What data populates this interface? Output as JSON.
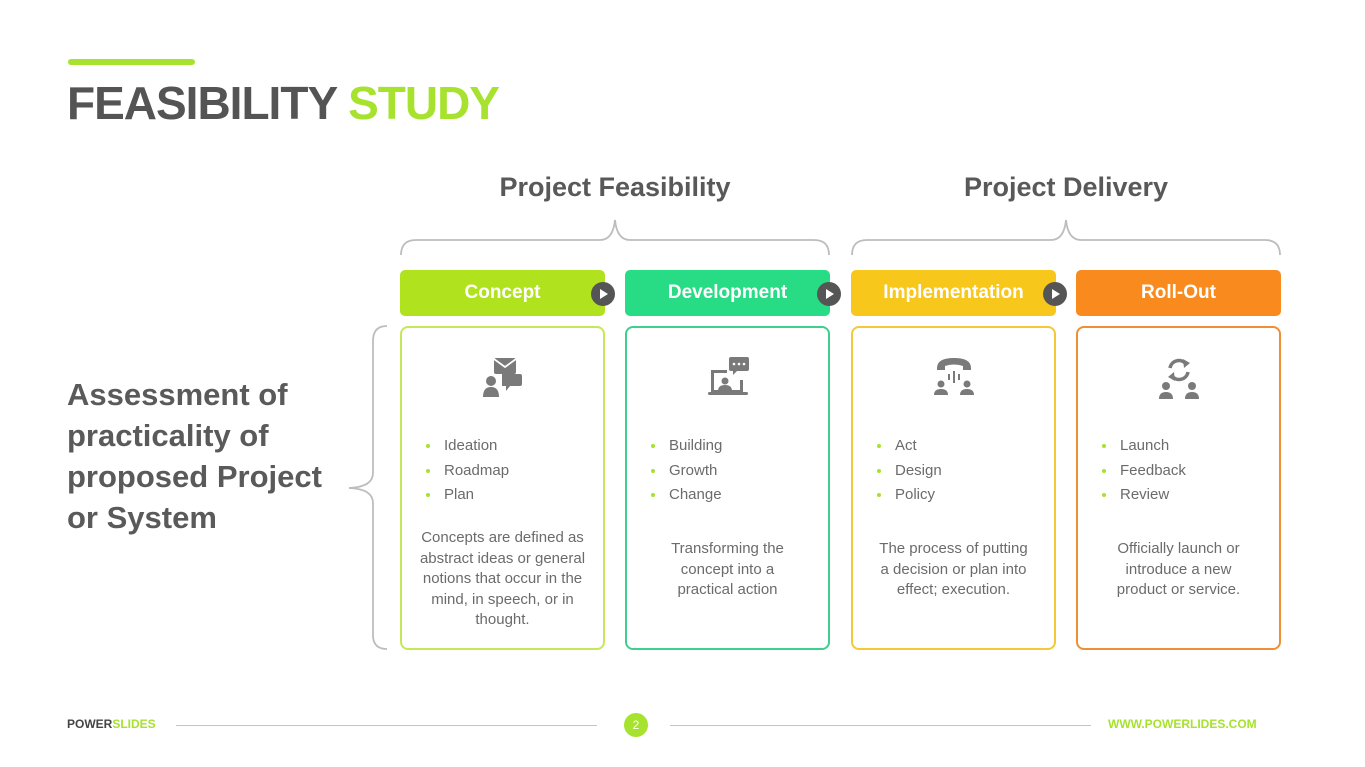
{
  "title": {
    "part1": "FEASIBILITY",
    "part2": "STUDY"
  },
  "groups": [
    {
      "label": "Project Feasibility"
    },
    {
      "label": "Project Delivery"
    }
  ],
  "left_text": "Assessment of practicality of proposed Project or System",
  "steps": [
    {
      "label": "Concept",
      "color": "#b0e31d",
      "border": "#c5e85a",
      "icon": "person-message-icon",
      "bullets": [
        "Ideation",
        "Roadmap",
        "Plan"
      ],
      "description": "Concepts are defined as abstract ideas or general notions that occur in the mind, in speech, or in thought."
    },
    {
      "label": "Development",
      "color": "#27dc85",
      "border": "#3ecf8e",
      "icon": "laptop-chat-icon",
      "bullets": [
        "Building",
        "Growth",
        "Change"
      ],
      "description": "Transforming the concept into a practical action"
    },
    {
      "label": "Implementation",
      "color": "#f8c71c",
      "border": "#f3c93a",
      "icon": "conference-call-icon",
      "bullets": [
        "Act",
        "Design",
        "Policy"
      ],
      "description": "The process of putting a decision or plan into effect; execution."
    },
    {
      "label": "Roll-Out",
      "color": "#f98a1d",
      "border": "#ef8f35",
      "icon": "team-sync-icon",
      "bullets": [
        "Launch",
        "Feedback",
        "Review"
      ],
      "description": "Officially launch or introduce a new product or service."
    }
  ],
  "footer": {
    "brand_part1": "POWER",
    "brand_part2": "SLIDES",
    "page_number": "2",
    "url": "WWW.POWERLIDES.COM"
  }
}
